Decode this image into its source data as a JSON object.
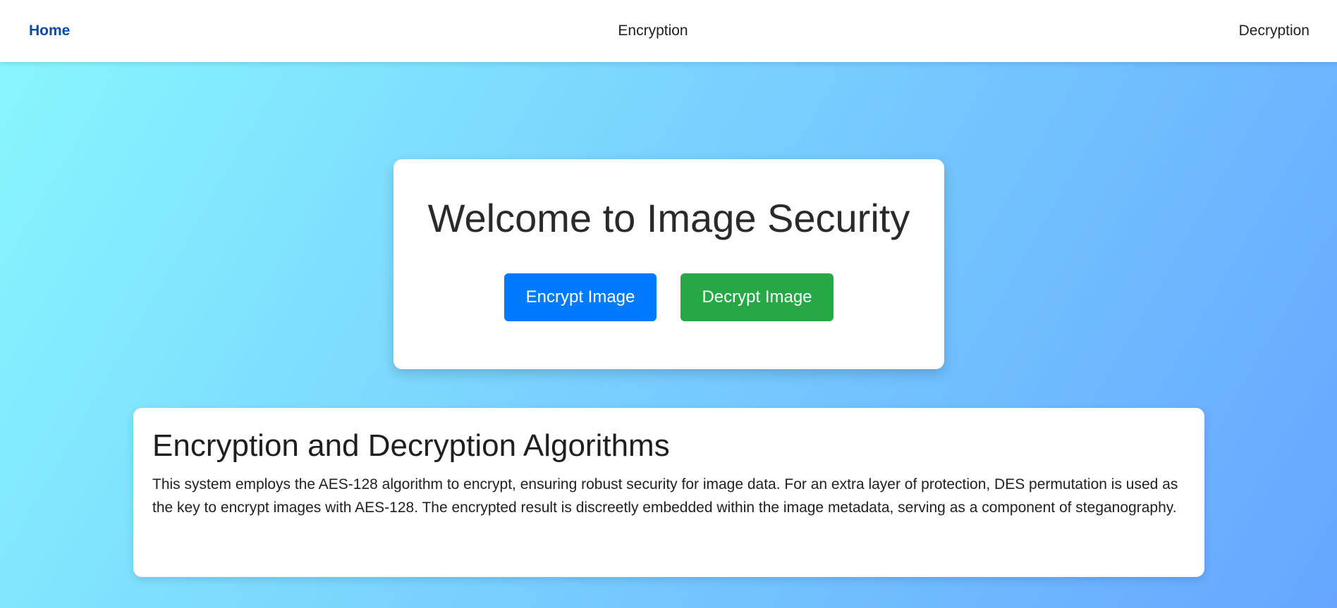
{
  "nav": {
    "home": "Home",
    "encryption": "Encryption",
    "decryption": "Decryption"
  },
  "hero": {
    "title": "Welcome to Image Security",
    "encrypt_button": "Encrypt Image",
    "decrypt_button": "Decrypt Image"
  },
  "info": {
    "title": "Encryption and Decryption Algorithms",
    "text": "This system employs the AES-128 algorithm to encrypt, ensuring robust security for image data. For an extra layer of protection, DES permutation is used as the key to encrypt images with AES-128. The encrypted result is discreetly embedded within the image metadata, serving as a component of steganography."
  },
  "colors": {
    "gradient_start": "#89f7fe",
    "gradient_end": "#66a6ff",
    "home_link": "#0b4aa6",
    "encrypt_button": "#007bff",
    "decrypt_button": "#28a745"
  }
}
